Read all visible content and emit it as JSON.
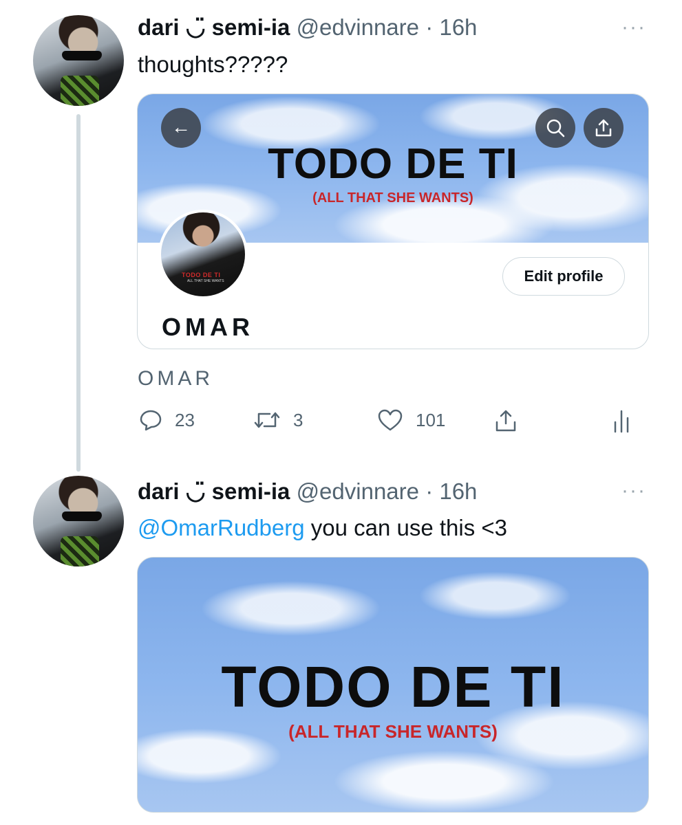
{
  "tweets": [
    {
      "display_name": "dari ◡̈ semi-ia",
      "handle": "@edvinnare",
      "time": "· 16h",
      "more": "···",
      "text": "thoughts?????",
      "card": {
        "banner_title": "TODO DE TI",
        "banner_subtitle": "(ALL THAT SHE WANTS)",
        "back_glyph": "←",
        "profile_pic_title": "TODO DE TI",
        "profile_pic_sub": "ALL THAT SHE WANTS",
        "edit_button": "Edit profile",
        "profile_name": "OMAR"
      },
      "link_title": "OMAR",
      "actions": {
        "replies": "23",
        "retweets": "3",
        "likes": "101"
      }
    },
    {
      "display_name": "dari ◡̈ semi-ia",
      "handle": "@edvinnare",
      "time": "· 16h",
      "more": "···",
      "mention": "@OmarRudberg",
      "text": " you can use this <3",
      "image": {
        "title": "TODO DE TI",
        "subtitle": "(ALL THAT SHE WANTS)"
      }
    }
  ],
  "icons": [
    "back-arrow-icon",
    "search-icon",
    "share-icon",
    "reply-icon",
    "retweet-icon",
    "like-icon",
    "share-icon",
    "analytics-icon",
    "more-icon"
  ],
  "colors": {
    "link": "#1d9bf0",
    "secondary_text": "#536471",
    "border": "#cfd9de",
    "banner_subtitle": "#c8262a"
  }
}
